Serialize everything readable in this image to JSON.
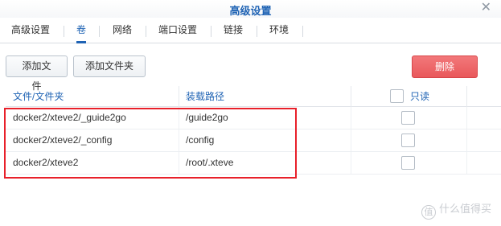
{
  "window": {
    "title": "高级设置",
    "close_glyph": "✕"
  },
  "tabs": [
    {
      "label": "高级设置"
    },
    {
      "label": "卷"
    },
    {
      "label": "网络"
    },
    {
      "label": "端口设置"
    },
    {
      "label": "链接"
    },
    {
      "label": "环境"
    }
  ],
  "active_tab": "卷",
  "toolbar": {
    "add_file": "添加文件",
    "add_folder": "添加文件夹",
    "delete": "删除"
  },
  "table": {
    "headers": {
      "path": "文件/文件夹",
      "mount": "装载路径",
      "readonly": "只读"
    },
    "rows": [
      {
        "path": "docker2/xteve2/_guide2go",
        "mount": "/guide2go",
        "readonly": false
      },
      {
        "path": "docker2/xteve2/_config",
        "mount": "/config",
        "readonly": false
      },
      {
        "path": "docker2/xteve2",
        "mount": "/root/.xteve",
        "readonly": false
      }
    ]
  },
  "watermark": {
    "logo_glyph": "值",
    "text": "什么值得买"
  },
  "colors": {
    "accent": "#1f63b4",
    "danger": "#e9585b",
    "highlight": "#e8202a"
  }
}
